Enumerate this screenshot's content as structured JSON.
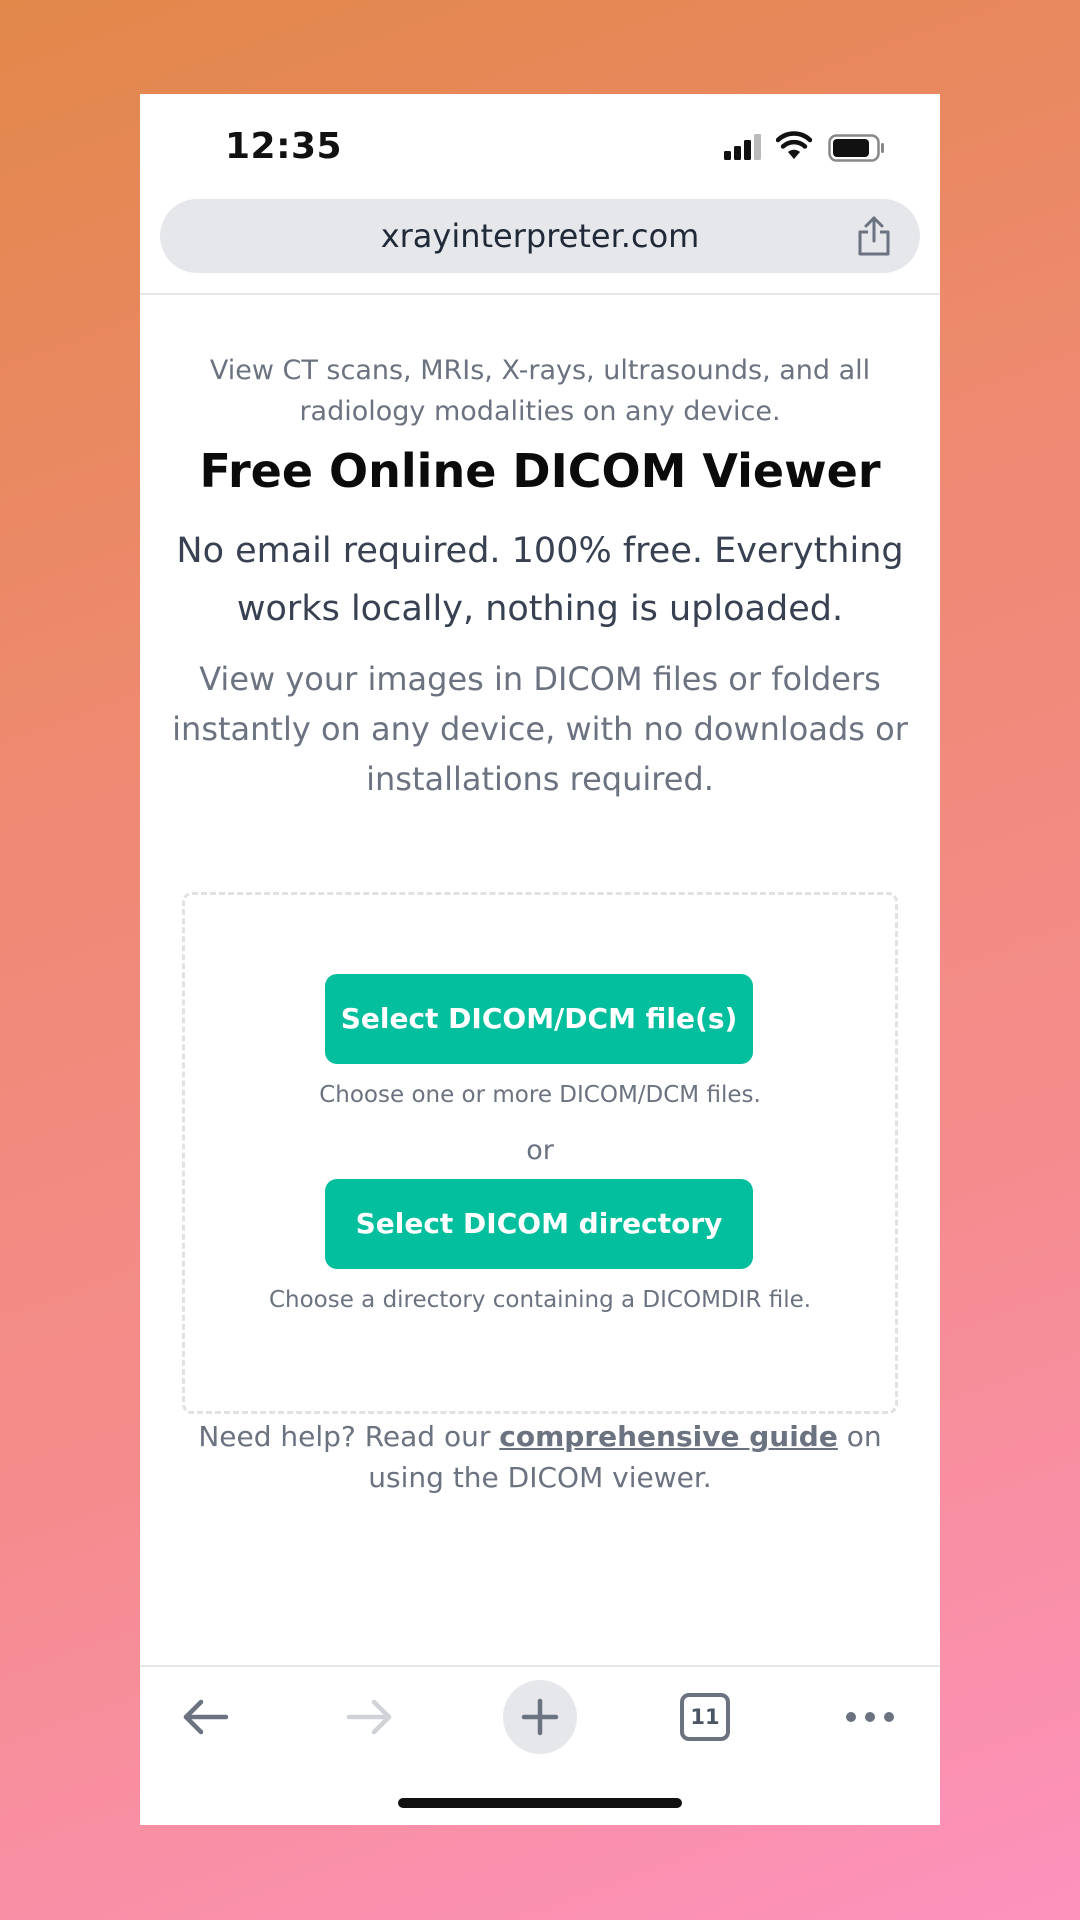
{
  "status_bar": {
    "time": "12:35",
    "icons": [
      "signal-icon",
      "wifi-icon",
      "battery-icon"
    ]
  },
  "address_bar": {
    "url": "xrayinterpreter.com",
    "share_icon": "share-icon"
  },
  "main": {
    "tagline": "View CT scans, MRIs, X-rays, ultrasounds, and all radiology modalities on any device.",
    "title": "Free Online DICOM Viewer",
    "subtitle": "No email required. 100% free. Everything works locally, nothing is uploaded.",
    "description": "View your images in DICOM files or folders instantly on any device, with no downloads or installations required.",
    "dropzone": {
      "files_button": "Select DICOM/DCM file(s)",
      "files_hint": "Choose one or more DICOM/DCM files.",
      "or": "or",
      "directory_button": "Select DICOM directory",
      "directory_hint": "Choose a directory containing a DICOMDIR file."
    },
    "help": {
      "prefix": "Need help? Read our ",
      "link": "comprehensive guide",
      "suffix": " on using the DICOM viewer."
    }
  },
  "toolbar": {
    "tab_count": "11",
    "icons": [
      "back-arrow-icon",
      "forward-arrow-icon",
      "plus-icon",
      "tabs-icon",
      "more-icon"
    ]
  },
  "colors": {
    "accent": "#04bf9d",
    "background_top": "#e2874a",
    "background_bottom": "#fd92bd"
  }
}
